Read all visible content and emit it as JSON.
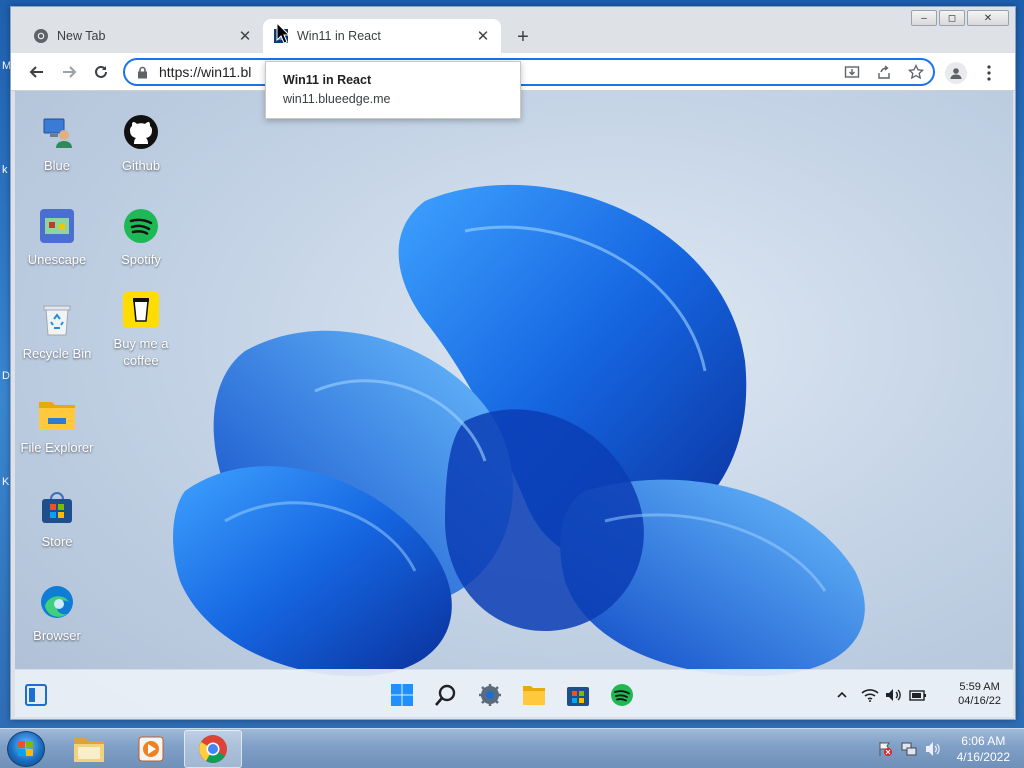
{
  "host": {
    "edge_letters": [
      "M",
      "k",
      "D",
      "K"
    ]
  },
  "browser": {
    "window_controls": {
      "minimize": "–",
      "maximize": "◻",
      "close": "✕"
    },
    "tabs": [
      {
        "title": "New Tab",
        "active": false,
        "favicon": "chrome-icon"
      },
      {
        "title": "Win11 in React",
        "active": true,
        "favicon": "win11-react-icon"
      }
    ],
    "new_tab_label": "+",
    "address": {
      "url": "https://win11.bl"
    },
    "tooltip": {
      "title": "Win11 in React",
      "url": "win11.blueedge.me"
    }
  },
  "desktop": {
    "icons": [
      {
        "name": "blue",
        "label": "Blue",
        "icon": "user-pc-icon"
      },
      {
        "name": "github",
        "label": "Github",
        "icon": "github-icon"
      },
      {
        "name": "unescape",
        "label": "Unescape",
        "icon": "game-icon"
      },
      {
        "name": "spotify",
        "label": "Spotify",
        "icon": "spotify-icon"
      },
      {
        "name": "recycle-bin",
        "label": "Recycle Bin",
        "icon": "recycle-bin-icon"
      },
      {
        "name": "buy-me-a-coffee",
        "label": "Buy me a coffee",
        "icon": "coffee-icon"
      },
      {
        "name": "file-explorer",
        "label": "File Explorer",
        "icon": "folder-icon"
      },
      {
        "name": "store",
        "label": "Store",
        "icon": "store-icon"
      },
      {
        "name": "browser",
        "label": "Browser",
        "icon": "edge-icon"
      }
    ],
    "taskbar": {
      "time": "5:59 AM",
      "date": "04/16/22"
    }
  },
  "win7": {
    "clock": {
      "time": "6:06 AM",
      "date": "4/16/2022"
    }
  },
  "colors": {
    "accent": "#1a73e8",
    "win11_blue": "#1565e0",
    "spotify": "#1db954",
    "coffee": "#ffdd00"
  }
}
